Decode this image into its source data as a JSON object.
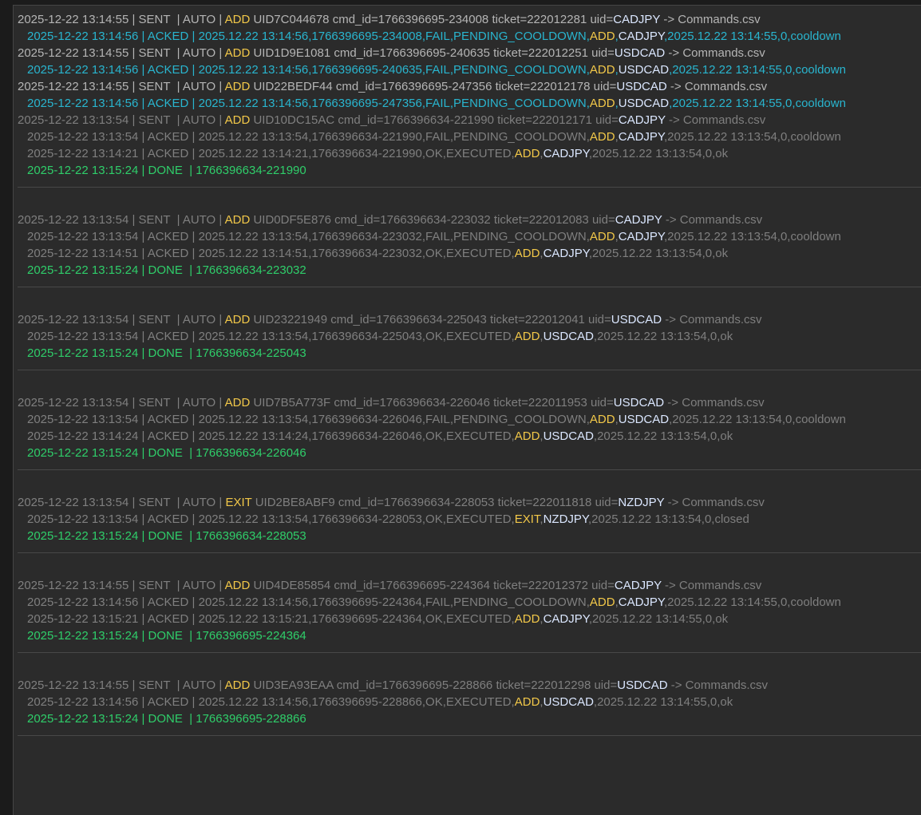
{
  "colors": {
    "background": "#2b2b2b",
    "highlight_text": "#b5b5b5",
    "dim_text": "#7f7f7f",
    "acked_active": "#29b5cf",
    "done": "#2fce6a",
    "command": "#f2c849",
    "symbol": "#dbe7ff"
  },
  "groups": [
    {
      "separator": false,
      "lines": [
        {
          "kind": "sent",
          "tone": "hi",
          "pre": "2025-12-22 13:14:55 | SENT  | AUTO | ",
          "cmd": "ADD",
          "mid": " UID7C044678 cmd_id=1766396695-234008 ticket=222012281 uid=",
          "pair": "CADJPY",
          "post": " -> Commands.csv"
        },
        {
          "kind": "acked",
          "tone": "cyan",
          "pre": "2025-12-22 13:14:56 | ACKED | 2025.12.22 13:14:56,1766396695-234008,FAIL,PENDING_COOLDOWN,",
          "cmd": "ADD",
          "mid": ",",
          "pair": "CADJPY",
          "post": ",2025.12.22 13:14:55,0,cooldown"
        },
        {
          "kind": "sent",
          "tone": "hi",
          "pre": "2025-12-22 13:14:55 | SENT  | AUTO | ",
          "cmd": "ADD",
          "mid": " UID1D9E1081 cmd_id=1766396695-240635 ticket=222012251 uid=",
          "pair": "USDCAD",
          "post": " -> Commands.csv"
        },
        {
          "kind": "acked",
          "tone": "cyan",
          "pre": "2025-12-22 13:14:56 | ACKED | 2025.12.22 13:14:56,1766396695-240635,FAIL,PENDING_COOLDOWN,",
          "cmd": "ADD",
          "mid": ",",
          "pair": "USDCAD",
          "post": ",2025.12.22 13:14:55,0,cooldown"
        },
        {
          "kind": "sent",
          "tone": "hi",
          "pre": "2025-12-22 13:14:55 | SENT  | AUTO | ",
          "cmd": "ADD",
          "mid": " UID22BEDF44 cmd_id=1766396695-247356 ticket=222012178 uid=",
          "pair": "USDCAD",
          "post": " -> Commands.csv"
        },
        {
          "kind": "acked",
          "tone": "cyan",
          "pre": "2025-12-22 13:14:56 | ACKED | 2025.12.22 13:14:56,1766396695-247356,FAIL,PENDING_COOLDOWN,",
          "cmd": "ADD",
          "mid": ",",
          "pair": "USDCAD",
          "post": ",2025.12.22 13:14:55,0,cooldown"
        },
        {
          "kind": "sent",
          "tone": "dim",
          "pre": "2025-12-22 13:13:54 | SENT  | AUTO | ",
          "cmd": "ADD",
          "mid": " UID10DC15AC cmd_id=1766396634-221990 ticket=222012171 uid=",
          "pair": "CADJPY",
          "post": " -> Commands.csv"
        },
        {
          "kind": "acked",
          "tone": "dim",
          "pre": "2025-12-22 13:13:54 | ACKED | 2025.12.22 13:13:54,1766396634-221990,FAIL,PENDING_COOLDOWN,",
          "cmd": "ADD",
          "mid": ",",
          "pair": "CADJPY",
          "post": ",2025.12.22 13:13:54,0,cooldown"
        },
        {
          "kind": "acked",
          "tone": "dim",
          "pre": "2025-12-22 13:14:21 | ACKED | 2025.12.22 13:14:21,1766396634-221990,OK,EXECUTED,",
          "cmd": "ADD",
          "mid": ",",
          "pair": "CADJPY",
          "post": ",2025.12.22 13:13:54,0,ok"
        },
        {
          "kind": "done",
          "tone": "done",
          "text": "2025-12-22 13:15:24 | DONE  | 1766396634-221990"
        }
      ]
    },
    {
      "separator": true,
      "lines": [
        {
          "kind": "sent",
          "tone": "dim",
          "pre": "2025-12-22 13:13:54 | SENT  | AUTO | ",
          "cmd": "ADD",
          "mid": " UID0DF5E876 cmd_id=1766396634-223032 ticket=222012083 uid=",
          "pair": "CADJPY",
          "post": " -> Commands.csv"
        },
        {
          "kind": "acked",
          "tone": "dim",
          "pre": "2025-12-22 13:13:54 | ACKED | 2025.12.22 13:13:54,1766396634-223032,FAIL,PENDING_COOLDOWN,",
          "cmd": "ADD",
          "mid": ",",
          "pair": "CADJPY",
          "post": ",2025.12.22 13:13:54,0,cooldown"
        },
        {
          "kind": "acked",
          "tone": "dim",
          "pre": "2025-12-22 13:14:51 | ACKED | 2025.12.22 13:14:51,1766396634-223032,OK,EXECUTED,",
          "cmd": "ADD",
          "mid": ",",
          "pair": "CADJPY",
          "post": ",2025.12.22 13:13:54,0,ok"
        },
        {
          "kind": "done",
          "tone": "done",
          "text": "2025-12-22 13:15:24 | DONE  | 1766396634-223032"
        }
      ]
    },
    {
      "separator": true,
      "lines": [
        {
          "kind": "sent",
          "tone": "dim",
          "pre": "2025-12-22 13:13:54 | SENT  | AUTO | ",
          "cmd": "ADD",
          "mid": " UID23221949 cmd_id=1766396634-225043 ticket=222012041 uid=",
          "pair": "USDCAD",
          "post": " -> Commands.csv"
        },
        {
          "kind": "acked",
          "tone": "dim",
          "pre": "2025-12-22 13:13:54 | ACKED | 2025.12.22 13:13:54,1766396634-225043,OK,EXECUTED,",
          "cmd": "ADD",
          "mid": ",",
          "pair": "USDCAD",
          "post": ",2025.12.22 13:13:54,0,ok"
        },
        {
          "kind": "done",
          "tone": "done",
          "text": "2025-12-22 13:15:24 | DONE  | 1766396634-225043"
        }
      ]
    },
    {
      "separator": true,
      "lines": [
        {
          "kind": "sent",
          "tone": "dim",
          "pre": "2025-12-22 13:13:54 | SENT  | AUTO | ",
          "cmd": "ADD",
          "mid": " UID7B5A773F cmd_id=1766396634-226046 ticket=222011953 uid=",
          "pair": "USDCAD",
          "post": " -> Commands.csv"
        },
        {
          "kind": "acked",
          "tone": "dim",
          "pre": "2025-12-22 13:13:54 | ACKED | 2025.12.22 13:13:54,1766396634-226046,FAIL,PENDING_COOLDOWN,",
          "cmd": "ADD",
          "mid": ",",
          "pair": "USDCAD",
          "post": ",2025.12.22 13:13:54,0,cooldown"
        },
        {
          "kind": "acked",
          "tone": "dim",
          "pre": "2025-12-22 13:14:24 | ACKED | 2025.12.22 13:14:24,1766396634-226046,OK,EXECUTED,",
          "cmd": "ADD",
          "mid": ",",
          "pair": "USDCAD",
          "post": ",2025.12.22 13:13:54,0,ok"
        },
        {
          "kind": "done",
          "tone": "done",
          "text": "2025-12-22 13:15:24 | DONE  | 1766396634-226046"
        }
      ]
    },
    {
      "separator": true,
      "lines": [
        {
          "kind": "sent",
          "tone": "dim",
          "pre": "2025-12-22 13:13:54 | SENT  | AUTO | ",
          "cmd": "EXIT",
          "mid": " UID2BE8ABF9 cmd_id=1766396634-228053 ticket=222011818 uid=",
          "pair": "NZDJPY",
          "post": " -> Commands.csv"
        },
        {
          "kind": "acked",
          "tone": "dim",
          "pre": "2025-12-22 13:13:54 | ACKED | 2025.12.22 13:13:54,1766396634-228053,OK,EXECUTED,",
          "cmd": "EXIT",
          "mid": ",",
          "pair": "NZDJPY",
          "post": ",2025.12.22 13:13:54,0,closed"
        },
        {
          "kind": "done",
          "tone": "done",
          "text": "2025-12-22 13:15:24 | DONE  | 1766396634-228053"
        }
      ]
    },
    {
      "separator": true,
      "lines": [
        {
          "kind": "sent",
          "tone": "dim",
          "pre": "2025-12-22 13:14:55 | SENT  | AUTO | ",
          "cmd": "ADD",
          "mid": " UID4DE85854 cmd_id=1766396695-224364 ticket=222012372 uid=",
          "pair": "CADJPY",
          "post": " -> Commands.csv"
        },
        {
          "kind": "acked",
          "tone": "dim",
          "pre": "2025-12-22 13:14:56 | ACKED | 2025.12.22 13:14:56,1766396695-224364,FAIL,PENDING_COOLDOWN,",
          "cmd": "ADD",
          "mid": ",",
          "pair": "CADJPY",
          "post": ",2025.12.22 13:14:55,0,cooldown"
        },
        {
          "kind": "acked",
          "tone": "dim",
          "pre": "2025-12-22 13:15:21 | ACKED | 2025.12.22 13:15:21,1766396695-224364,OK,EXECUTED,",
          "cmd": "ADD",
          "mid": ",",
          "pair": "CADJPY",
          "post": ",2025.12.22 13:14:55,0,ok"
        },
        {
          "kind": "done",
          "tone": "done",
          "text": "2025-12-22 13:15:24 | DONE  | 1766396695-224364"
        }
      ]
    },
    {
      "separator": true,
      "lines": [
        {
          "kind": "sent",
          "tone": "dim",
          "pre": "2025-12-22 13:14:55 | SENT  | AUTO | ",
          "cmd": "ADD",
          "mid": " UID3EA93EAA cmd_id=1766396695-228866 ticket=222012298 uid=",
          "pair": "USDCAD",
          "post": " -> Commands.csv"
        },
        {
          "kind": "acked",
          "tone": "dim",
          "pre": "2025-12-22 13:14:56 | ACKED | 2025.12.22 13:14:56,1766396695-228866,OK,EXECUTED,",
          "cmd": "ADD",
          "mid": ",",
          "pair": "USDCAD",
          "post": ",2025.12.22 13:14:55,0,ok"
        },
        {
          "kind": "done",
          "tone": "done",
          "text": "2025-12-22 13:15:24 | DONE  | 1766396695-228866"
        }
      ]
    }
  ],
  "trailing_separator": true
}
